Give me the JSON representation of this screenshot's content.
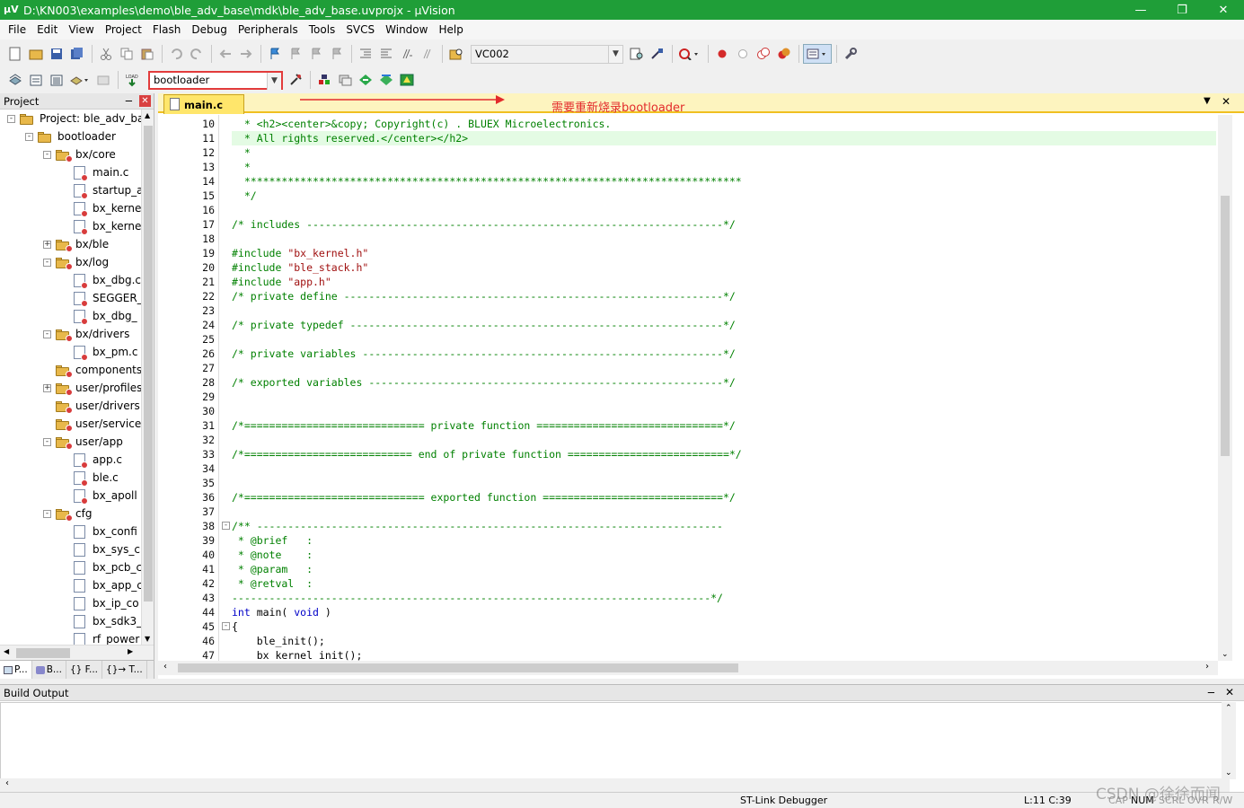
{
  "window": {
    "title": "D:\\KN003\\examples\\demo\\ble_adv_base\\mdk\\ble_adv_base.uvprojx - µVision"
  },
  "menu": [
    "File",
    "Edit",
    "View",
    "Project",
    "Flash",
    "Debug",
    "Peripherals",
    "Tools",
    "SVCS",
    "Window",
    "Help"
  ],
  "toolbar": {
    "target_combo": "VC002",
    "target_select": "bootloader"
  },
  "annotation": "需要重新烧录bootloader",
  "project": {
    "header": "Project",
    "tree": [
      {
        "label": "Project: ble_adv_bas",
        "level": 0,
        "kind": "project",
        "expander": "-"
      },
      {
        "label": "bootloader",
        "level": 1,
        "kind": "target",
        "expander": "-"
      },
      {
        "label": "bx/core",
        "level": 2,
        "kind": "group",
        "expander": "-"
      },
      {
        "label": "main.c",
        "level": 3,
        "kind": "file"
      },
      {
        "label": "startup_a",
        "level": 3,
        "kind": "file"
      },
      {
        "label": "bx_kerne",
        "level": 3,
        "kind": "file"
      },
      {
        "label": "bx_kerne",
        "level": 3,
        "kind": "file"
      },
      {
        "label": "bx/ble",
        "level": 2,
        "kind": "group",
        "expander": "+"
      },
      {
        "label": "bx/log",
        "level": 2,
        "kind": "group",
        "expander": "-"
      },
      {
        "label": "bx_dbg.c",
        "level": 3,
        "kind": "file"
      },
      {
        "label": "SEGGER_",
        "level": 3,
        "kind": "file"
      },
      {
        "label": "bx_dbg_",
        "level": 3,
        "kind": "file"
      },
      {
        "label": "bx/drivers",
        "level": 2,
        "kind": "group",
        "expander": "-"
      },
      {
        "label": "bx_pm.c",
        "level": 3,
        "kind": "file"
      },
      {
        "label": "components",
        "level": 2,
        "kind": "group",
        "expander": ""
      },
      {
        "label": "user/profiles",
        "level": 2,
        "kind": "group",
        "expander": "+"
      },
      {
        "label": "user/drivers",
        "level": 2,
        "kind": "group",
        "expander": ""
      },
      {
        "label": "user/service",
        "level": 2,
        "kind": "group",
        "expander": ""
      },
      {
        "label": "user/app",
        "level": 2,
        "kind": "group",
        "expander": "-"
      },
      {
        "label": "app.c",
        "level": 3,
        "kind": "file"
      },
      {
        "label": "ble.c",
        "level": 3,
        "kind": "file"
      },
      {
        "label": "bx_apoll",
        "level": 3,
        "kind": "file"
      },
      {
        "label": "cfg",
        "level": 2,
        "kind": "group",
        "expander": "-"
      },
      {
        "label": "bx_confi",
        "level": 3,
        "kind": "hfile"
      },
      {
        "label": "bx_sys_c",
        "level": 3,
        "kind": "hfile"
      },
      {
        "label": "bx_pcb_c",
        "level": 3,
        "kind": "hfile"
      },
      {
        "label": "bx_app_c",
        "level": 3,
        "kind": "hfile"
      },
      {
        "label": "bx_ip_co",
        "level": 3,
        "kind": "hfile"
      },
      {
        "label": "bx_sdk3_",
        "level": 3,
        "kind": "hfile"
      },
      {
        "label": "rf_power",
        "level": 3,
        "kind": "hfile"
      }
    ],
    "tabs": [
      "P...",
      "B...",
      "{} F...",
      "{}→ T..."
    ]
  },
  "editor": {
    "tab": "main.c",
    "lines": [
      {
        "n": 10,
        "t": "  * <h2><center>&copy; Copyright(c) . BLUEX Microelectronics."
      },
      {
        "n": 11,
        "t": "  * All rights reserved.</center></h2>",
        "hl": true
      },
      {
        "n": 12,
        "t": "  *"
      },
      {
        "n": 13,
        "t": "  *"
      },
      {
        "n": 14,
        "t": "  ********************************************************************************"
      },
      {
        "n": 15,
        "t": "  */"
      },
      {
        "n": 16,
        "t": ""
      },
      {
        "n": 17,
        "t": "/* includes -------------------------------------------------------------------*/"
      },
      {
        "n": 18,
        "t": ""
      },
      {
        "n": 19,
        "t": "#include \"bx_kernel.h\"",
        "pp": true
      },
      {
        "n": 20,
        "t": "#include \"ble_stack.h\"",
        "pp": true
      },
      {
        "n": 21,
        "t": "#include \"app.h\"",
        "pp": true
      },
      {
        "n": 22,
        "t": "/* private define -------------------------------------------------------------*/"
      },
      {
        "n": 23,
        "t": ""
      },
      {
        "n": 24,
        "t": "/* private typedef ------------------------------------------------------------*/"
      },
      {
        "n": 25,
        "t": ""
      },
      {
        "n": 26,
        "t": "/* private variables ----------------------------------------------------------*/"
      },
      {
        "n": 27,
        "t": ""
      },
      {
        "n": 28,
        "t": "/* exported variables ---------------------------------------------------------*/"
      },
      {
        "n": 29,
        "t": ""
      },
      {
        "n": 30,
        "t": ""
      },
      {
        "n": 31,
        "t": "/*============================= private function ==============================*/"
      },
      {
        "n": 32,
        "t": ""
      },
      {
        "n": 33,
        "t": "/*=========================== end of private function ==========================*/"
      },
      {
        "n": 34,
        "t": ""
      },
      {
        "n": 35,
        "t": ""
      },
      {
        "n": 36,
        "t": "/*============================= exported function =============================*/"
      },
      {
        "n": 37,
        "t": ""
      },
      {
        "n": 38,
        "t": "/** ---------------------------------------------------------------------------",
        "fold": "-"
      },
      {
        "n": 39,
        "t": " * @brief   :"
      },
      {
        "n": 40,
        "t": " * @note    :"
      },
      {
        "n": 41,
        "t": " * @param   :"
      },
      {
        "n": 42,
        "t": " * @retval  :"
      },
      {
        "n": 43,
        "t": "-----------------------------------------------------------------------------*/"
      },
      {
        "n": 44,
        "t": "int main( void )",
        "kw": true
      },
      {
        "n": 45,
        "t": "{",
        "kw": true,
        "fold": "-"
      },
      {
        "n": 46,
        "t": "    ble_init();",
        "kw": true
      },
      {
        "n": 47,
        "t": "    bx_kernel_init();",
        "kw": true
      }
    ]
  },
  "build": {
    "header": "Build Output"
  },
  "status": {
    "debugger": "ST-Link Debugger",
    "position": "L:11 C:39",
    "caps": "CAP",
    "num": "NUM",
    "scrl": "SCRL",
    "ovr": "OVR",
    "rw": "R/W"
  },
  "watermark": "CSDN @徐徐而闻",
  "colors": {
    "titlebar": "#1f9e38",
    "annotation": "#e32b2b",
    "tab_active": "#ffe66b",
    "highlight_line": "#e4fbe4",
    "comment": "#008000",
    "keyword": "#0000c8"
  }
}
